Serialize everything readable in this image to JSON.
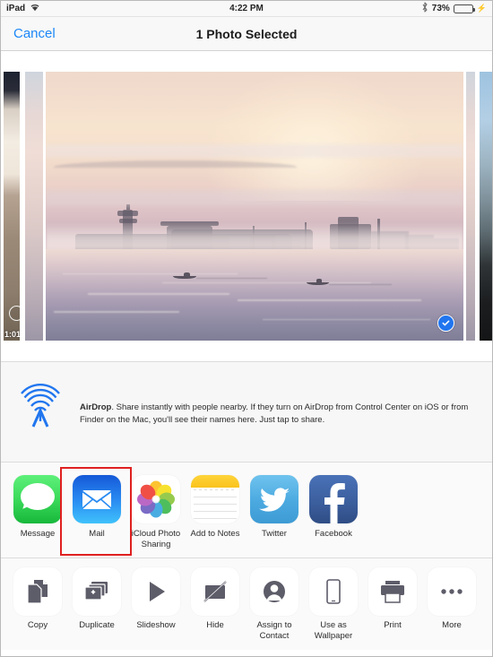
{
  "status_bar": {
    "device": "iPad",
    "wifi_icon": "wifi-icon",
    "time": "4:22 PM",
    "bluetooth_icon": "bluetooth-icon",
    "battery_percent": "73%",
    "battery_level": 73,
    "battery_color": "#3fcb4a",
    "charging_icon": "lightning-bolt-icon"
  },
  "nav_bar": {
    "cancel_label": "Cancel",
    "title": "1 Photo Selected",
    "accent_color": "#1b87f7"
  },
  "photo_strip": {
    "left_thumb": {
      "duration": "1:01",
      "selected": false
    },
    "selected_photo": {
      "selected": true,
      "check_color": "#2176ef",
      "description": "misty sunrise seascape with pagoda silhouette and two boats"
    },
    "right_thumb": {
      "selected": false
    }
  },
  "airdrop": {
    "icon": "airdrop-icon",
    "title": "AirDrop",
    "body": ". Share instantly with people nearby. If they turn on AirDrop from Control Center on iOS or from Finder on the Mac, you'll see their names here. Just tap to share.",
    "accent_color": "#2176ef"
  },
  "share_apps": {
    "highlighted_index": 1,
    "highlight_color": "#e02020",
    "items": [
      {
        "label": "Message",
        "icon": "messages-icon"
      },
      {
        "label": "Mail",
        "icon": "mail-icon"
      },
      {
        "label": "iCloud Photo Sharing",
        "icon": "photos-icon"
      },
      {
        "label": "Add to Notes",
        "icon": "notes-icon"
      },
      {
        "label": "Twitter",
        "icon": "twitter-icon"
      },
      {
        "label": "Facebook",
        "icon": "facebook-icon"
      }
    ]
  },
  "actions": {
    "items": [
      {
        "label": "Copy",
        "icon": "copy-icon"
      },
      {
        "label": "Duplicate",
        "icon": "duplicate-icon"
      },
      {
        "label": "Slideshow",
        "icon": "play-icon"
      },
      {
        "label": "Hide",
        "icon": "hide-icon"
      },
      {
        "label": "Assign to Contact",
        "icon": "person-icon"
      },
      {
        "label": "Use as Wallpaper",
        "icon": "device-icon"
      },
      {
        "label": "Print",
        "icon": "printer-icon"
      },
      {
        "label": "More",
        "icon": "ellipsis-icon"
      }
    ]
  }
}
